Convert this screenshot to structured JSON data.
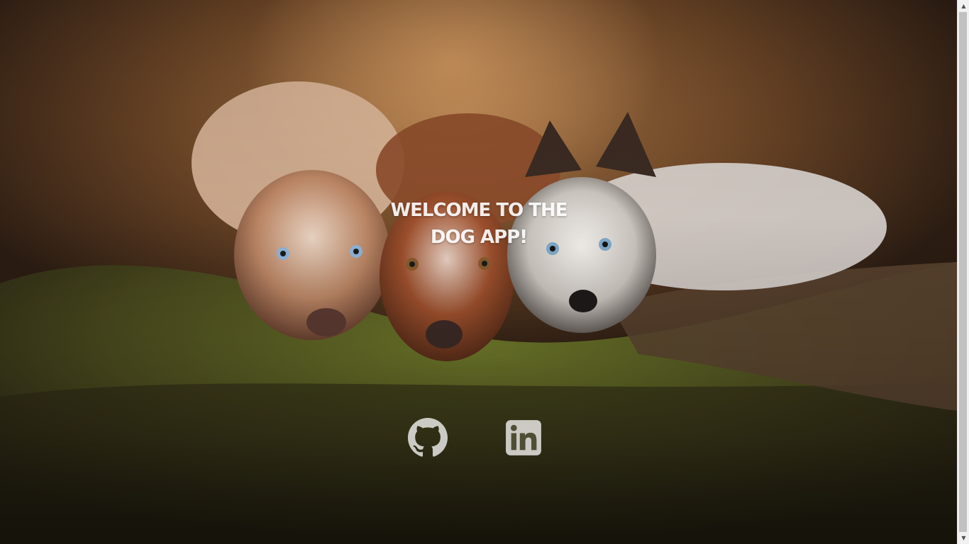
{
  "hero": {
    "heading": "WELCOME TO THE DOG APP!",
    "background_icon": "dogs-on-moss-photo"
  },
  "social_links": [
    {
      "name": "github",
      "icon": "github-icon",
      "color": "#ffffff"
    },
    {
      "name": "linkedin",
      "icon": "linkedin-icon",
      "color": "#ffffff"
    }
  ],
  "scrollbar": {
    "up_arrow": "▲",
    "down_arrow": "▼"
  }
}
